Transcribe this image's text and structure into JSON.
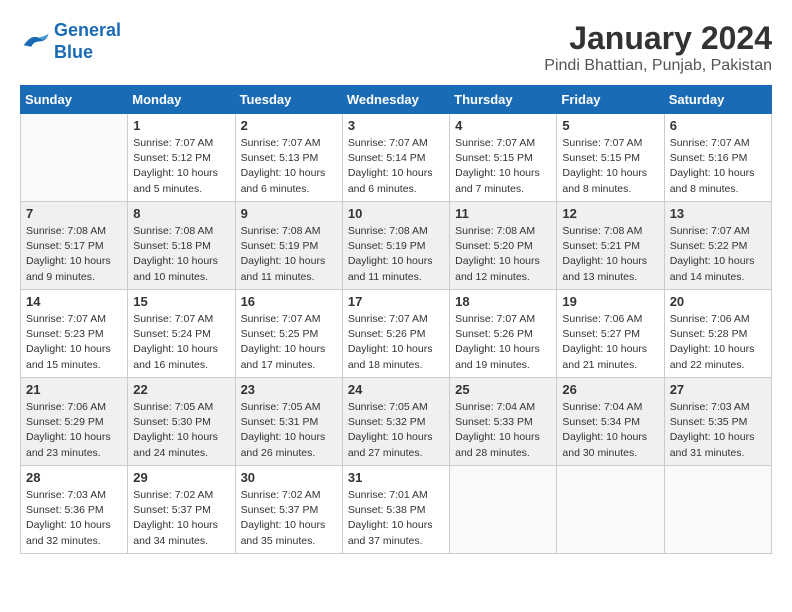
{
  "logo": {
    "line1": "General",
    "line2": "Blue"
  },
  "title": "January 2024",
  "subtitle": "Pindi Bhattian, Punjab, Pakistan",
  "days_of_week": [
    "Sunday",
    "Monday",
    "Tuesday",
    "Wednesday",
    "Thursday",
    "Friday",
    "Saturday"
  ],
  "weeks": [
    [
      {
        "day": "",
        "sunrise": "",
        "sunset": "",
        "daylight": ""
      },
      {
        "day": "1",
        "sunrise": "Sunrise: 7:07 AM",
        "sunset": "Sunset: 5:12 PM",
        "daylight": "Daylight: 10 hours and 5 minutes."
      },
      {
        "day": "2",
        "sunrise": "Sunrise: 7:07 AM",
        "sunset": "Sunset: 5:13 PM",
        "daylight": "Daylight: 10 hours and 6 minutes."
      },
      {
        "day": "3",
        "sunrise": "Sunrise: 7:07 AM",
        "sunset": "Sunset: 5:14 PM",
        "daylight": "Daylight: 10 hours and 6 minutes."
      },
      {
        "day": "4",
        "sunrise": "Sunrise: 7:07 AM",
        "sunset": "Sunset: 5:15 PM",
        "daylight": "Daylight: 10 hours and 7 minutes."
      },
      {
        "day": "5",
        "sunrise": "Sunrise: 7:07 AM",
        "sunset": "Sunset: 5:15 PM",
        "daylight": "Daylight: 10 hours and 8 minutes."
      },
      {
        "day": "6",
        "sunrise": "Sunrise: 7:07 AM",
        "sunset": "Sunset: 5:16 PM",
        "daylight": "Daylight: 10 hours and 8 minutes."
      }
    ],
    [
      {
        "day": "7",
        "sunrise": "Sunrise: 7:08 AM",
        "sunset": "Sunset: 5:17 PM",
        "daylight": "Daylight: 10 hours and 9 minutes."
      },
      {
        "day": "8",
        "sunrise": "Sunrise: 7:08 AM",
        "sunset": "Sunset: 5:18 PM",
        "daylight": "Daylight: 10 hours and 10 minutes."
      },
      {
        "day": "9",
        "sunrise": "Sunrise: 7:08 AM",
        "sunset": "Sunset: 5:19 PM",
        "daylight": "Daylight: 10 hours and 11 minutes."
      },
      {
        "day": "10",
        "sunrise": "Sunrise: 7:08 AM",
        "sunset": "Sunset: 5:19 PM",
        "daylight": "Daylight: 10 hours and 11 minutes."
      },
      {
        "day": "11",
        "sunrise": "Sunrise: 7:08 AM",
        "sunset": "Sunset: 5:20 PM",
        "daylight": "Daylight: 10 hours and 12 minutes."
      },
      {
        "day": "12",
        "sunrise": "Sunrise: 7:08 AM",
        "sunset": "Sunset: 5:21 PM",
        "daylight": "Daylight: 10 hours and 13 minutes."
      },
      {
        "day": "13",
        "sunrise": "Sunrise: 7:07 AM",
        "sunset": "Sunset: 5:22 PM",
        "daylight": "Daylight: 10 hours and 14 minutes."
      }
    ],
    [
      {
        "day": "14",
        "sunrise": "Sunrise: 7:07 AM",
        "sunset": "Sunset: 5:23 PM",
        "daylight": "Daylight: 10 hours and 15 minutes."
      },
      {
        "day": "15",
        "sunrise": "Sunrise: 7:07 AM",
        "sunset": "Sunset: 5:24 PM",
        "daylight": "Daylight: 10 hours and 16 minutes."
      },
      {
        "day": "16",
        "sunrise": "Sunrise: 7:07 AM",
        "sunset": "Sunset: 5:25 PM",
        "daylight": "Daylight: 10 hours and 17 minutes."
      },
      {
        "day": "17",
        "sunrise": "Sunrise: 7:07 AM",
        "sunset": "Sunset: 5:26 PM",
        "daylight": "Daylight: 10 hours and 18 minutes."
      },
      {
        "day": "18",
        "sunrise": "Sunrise: 7:07 AM",
        "sunset": "Sunset: 5:26 PM",
        "daylight": "Daylight: 10 hours and 19 minutes."
      },
      {
        "day": "19",
        "sunrise": "Sunrise: 7:06 AM",
        "sunset": "Sunset: 5:27 PM",
        "daylight": "Daylight: 10 hours and 21 minutes."
      },
      {
        "day": "20",
        "sunrise": "Sunrise: 7:06 AM",
        "sunset": "Sunset: 5:28 PM",
        "daylight": "Daylight: 10 hours and 22 minutes."
      }
    ],
    [
      {
        "day": "21",
        "sunrise": "Sunrise: 7:06 AM",
        "sunset": "Sunset: 5:29 PM",
        "daylight": "Daylight: 10 hours and 23 minutes."
      },
      {
        "day": "22",
        "sunrise": "Sunrise: 7:05 AM",
        "sunset": "Sunset: 5:30 PM",
        "daylight": "Daylight: 10 hours and 24 minutes."
      },
      {
        "day": "23",
        "sunrise": "Sunrise: 7:05 AM",
        "sunset": "Sunset: 5:31 PM",
        "daylight": "Daylight: 10 hours and 26 minutes."
      },
      {
        "day": "24",
        "sunrise": "Sunrise: 7:05 AM",
        "sunset": "Sunset: 5:32 PM",
        "daylight": "Daylight: 10 hours and 27 minutes."
      },
      {
        "day": "25",
        "sunrise": "Sunrise: 7:04 AM",
        "sunset": "Sunset: 5:33 PM",
        "daylight": "Daylight: 10 hours and 28 minutes."
      },
      {
        "day": "26",
        "sunrise": "Sunrise: 7:04 AM",
        "sunset": "Sunset: 5:34 PM",
        "daylight": "Daylight: 10 hours and 30 minutes."
      },
      {
        "day": "27",
        "sunrise": "Sunrise: 7:03 AM",
        "sunset": "Sunset: 5:35 PM",
        "daylight": "Daylight: 10 hours and 31 minutes."
      }
    ],
    [
      {
        "day": "28",
        "sunrise": "Sunrise: 7:03 AM",
        "sunset": "Sunset: 5:36 PM",
        "daylight": "Daylight: 10 hours and 32 minutes."
      },
      {
        "day": "29",
        "sunrise": "Sunrise: 7:02 AM",
        "sunset": "Sunset: 5:37 PM",
        "daylight": "Daylight: 10 hours and 34 minutes."
      },
      {
        "day": "30",
        "sunrise": "Sunrise: 7:02 AM",
        "sunset": "Sunset: 5:37 PM",
        "daylight": "Daylight: 10 hours and 35 minutes."
      },
      {
        "day": "31",
        "sunrise": "Sunrise: 7:01 AM",
        "sunset": "Sunset: 5:38 PM",
        "daylight": "Daylight: 10 hours and 37 minutes."
      },
      {
        "day": "",
        "sunrise": "",
        "sunset": "",
        "daylight": ""
      },
      {
        "day": "",
        "sunrise": "",
        "sunset": "",
        "daylight": ""
      },
      {
        "day": "",
        "sunrise": "",
        "sunset": "",
        "daylight": ""
      }
    ]
  ]
}
